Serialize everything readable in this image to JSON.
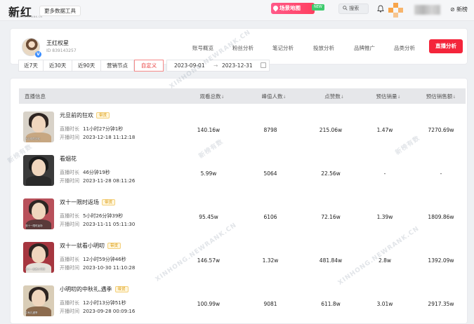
{
  "header": {
    "logo": "新红",
    "logo_sub": "XINHONG.NEWRANK.CN",
    "more_tools": "更多数据工具",
    "scene_map": "场景地图",
    "new_badge": "NEW",
    "search": "搜索",
    "new_list": "新榜"
  },
  "profile": {
    "name": "王红权星",
    "id": "ID 839143257",
    "verified_icon": "V",
    "tabs": [
      "账号概览",
      "粉丝分析",
      "笔记分析",
      "投放分析",
      "品牌推广",
      "品类分析"
    ],
    "live_tab": "直播分析"
  },
  "filters": {
    "buttons": [
      "近7天",
      "近30天",
      "近90天",
      "营销节点",
      "自定义"
    ],
    "active": "自定义",
    "start_date": "2023-09-01",
    "end_date": "2023-12-31",
    "arrow": "→"
  },
  "table": {
    "columns": [
      "直播信息",
      "观看总数",
      "峰值人数",
      "点赞数",
      "预估销量",
      "预估销售额"
    ],
    "sort_icon": "↓",
    "duration_label": "直播时长",
    "start_label": "开播时间",
    "tag_label": "带货",
    "rows": [
      {
        "title": "元旦前的狂欢",
        "tag": true,
        "duration": "11小时27分钟1秒",
        "start": "2023-12-18 11:12:18",
        "views": "140.16w",
        "peak": "8798",
        "likes": "215.06w",
        "sales": "1.47w",
        "revenue": "7270.69w",
        "thumb_caption": "元旦前的狂欢"
      },
      {
        "title": "看烟花",
        "tag": false,
        "duration": "46分钟19秒",
        "start": "2023-11-28 08:11:26",
        "views": "5.99w",
        "peak": "5064",
        "likes": "22.56w",
        "sales": "-",
        "revenue": "-",
        "thumb_caption": ""
      },
      {
        "title": "双十一限时返场",
        "tag": true,
        "duration": "5小时26分钟39秒",
        "start": "2023-11-11 05:11:30",
        "views": "95.45w",
        "peak": "6106",
        "likes": "72.16w",
        "sales": "1.39w",
        "revenue": "1809.86w",
        "thumb_caption": "双十一限时返场"
      },
      {
        "title": "双十一就看小明叨",
        "tag": true,
        "duration": "12小时59分钟46秒",
        "start": "2023-10-30 11:10:28",
        "views": "146.57w",
        "peak": "1.32w",
        "likes": "481.84w",
        "sales": "2.8w",
        "revenue": "1392.09w",
        "thumb_caption": "双十一就看小明叨"
      },
      {
        "title": "小明叨的中秋礼,遇季",
        "tag": true,
        "duration": "12小时13分钟51秒",
        "start": "2023-09-28 00:09:16",
        "views": "100.99w",
        "peak": "9081",
        "likes": "611.8w",
        "sales": "3.01w",
        "revenue": "2917.35w",
        "thumb_caption": "中秋礼遇季"
      }
    ]
  },
  "watermark_text": "XINHONG.NEWRANK.CN",
  "watermark_cn": "新榜有数",
  "colors": {
    "accent": "#f4253b",
    "tag_bg": "#fff6dc",
    "tag_text": "#d89400",
    "map_badge": "#ff3f5f"
  }
}
